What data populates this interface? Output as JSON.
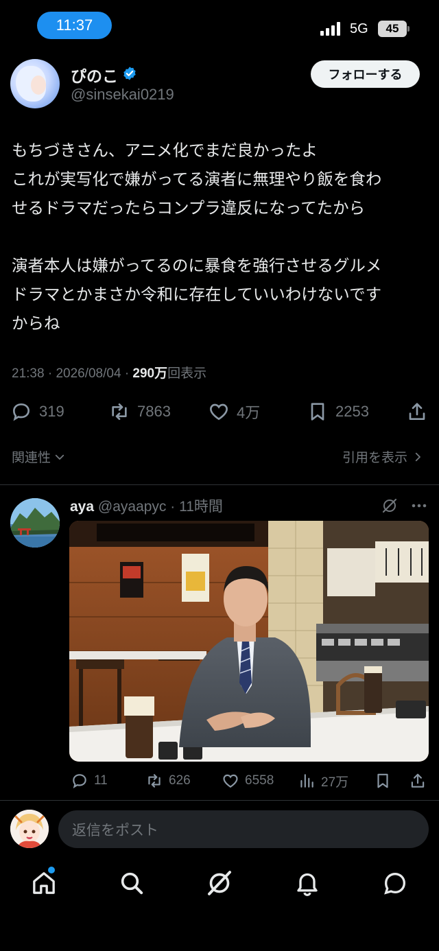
{
  "status_bar": {
    "time": "11:37",
    "network": "5G",
    "battery": "45"
  },
  "post": {
    "author": {
      "name": "ぴのこ",
      "handle": "@sinsekai0219",
      "verified": true
    },
    "follow_label": "フォローする",
    "body_paragraphs": [
      [
        "もちづきさん、アニメ化でまだ良かったよ",
        "これが実写化で嫌がってる演者に無理やり飯を食わ",
        "せるドラマだったらコンプラ違反になってたから"
      ],
      [
        "演者本人は嫌がってるのに暴食を強行させるグルメ",
        "ドラマとかまさか令和に存在していいわけないです",
        "からね"
      ]
    ],
    "time": "21:38",
    "date": "2026/08/04",
    "views_count": "290万",
    "views_label": "回表示",
    "stats": {
      "replies": "319",
      "reposts": "7863",
      "likes": "4万",
      "bookmarks": "2253"
    },
    "related_label": "関連性",
    "quotes_label": "引用を表示"
  },
  "reply": {
    "name": "aya",
    "handle": "@ayaapyc",
    "time_ago": "11時間",
    "more_icon": "more-icon",
    "stats": {
      "replies": "11",
      "reposts": "626",
      "likes": "6558",
      "views": "27万"
    }
  },
  "composer": {
    "placeholder": "返信をポスト"
  },
  "tabbar": {
    "items": [
      "home-icon",
      "search-icon",
      "grok-icon",
      "notifications-icon",
      "messages-icon"
    ],
    "home_badge": true
  },
  "colors": {
    "accent": "#1d9bf0",
    "text": "#e7e9ea",
    "muted": "#71767b",
    "background": "#000000"
  }
}
